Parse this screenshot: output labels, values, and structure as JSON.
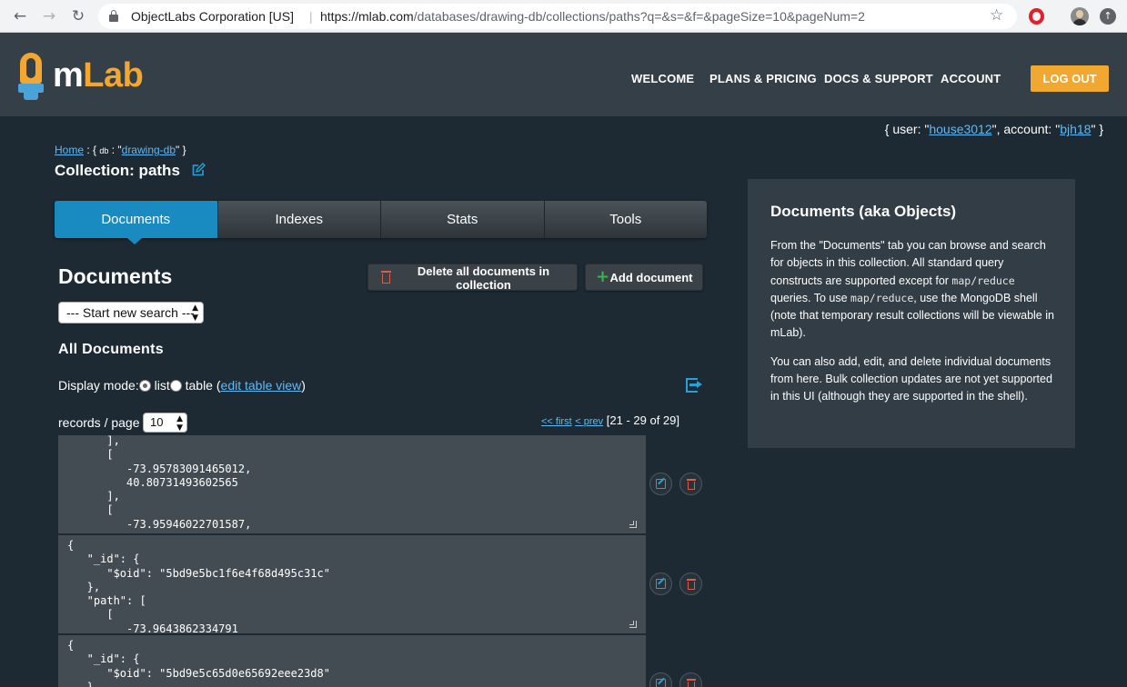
{
  "browser": {
    "site_owner": "ObjectLabs Corporation [US]",
    "separator": "|",
    "url_host": "https://mlab.com",
    "url_path": "/databases/drawing-db/collections/paths?q=&s=&f=&pageSize=10&pageNum=2",
    "icons": [
      "back-arrow-icon",
      "forward-arrow-icon",
      "reload-icon",
      "lock-icon",
      "star-icon",
      "opera-icon",
      "profile-avatar-icon",
      "update-icon"
    ]
  },
  "header": {
    "logo_m": "m",
    "logo_lab": "Lab",
    "nav": [
      "WELCOME",
      "PLANS & PRICING",
      "DOCS & SUPPORT",
      "ACCOUNT"
    ],
    "logout_label": "LOG OUT",
    "accent_color": "#f0a830",
    "background_color": "#353f47"
  },
  "userline": {
    "prefix": "{ user: \"",
    "user": "house3012",
    "middle": "\", account: \"",
    "account": "bjh18",
    "suffix": "\" }"
  },
  "breadcrumb": {
    "home": "Home",
    "sep1": " : { ",
    "db_label": "db",
    "sep2": " : \"",
    "db_name": "drawing-db",
    "sep3": "\" }"
  },
  "collection_title": "Collection: paths",
  "tabs": [
    {
      "label": "Documents",
      "active": true
    },
    {
      "label": "Indexes",
      "active": false
    },
    {
      "label": "Stats",
      "active": false
    },
    {
      "label": "Tools",
      "active": false
    }
  ],
  "documents": {
    "heading": "Documents",
    "delete_all_label": "Delete all documents in collection",
    "add_label": "Add document",
    "search_select_value": "--- Start new search ---",
    "all_documents_heading": "All Documents",
    "display_mode_label": "Display mode:",
    "mode_list": "list",
    "mode_table": "table (",
    "edit_table_view": "edit table view",
    "mode_close": ")",
    "records_per_page_label": "records / page",
    "page_size": "10",
    "pager_first": "<< first",
    "pager_prev": "< prev",
    "pager_range": "[21 - 29 of 29]",
    "items": [
      {
        "text": "      ],\n      [\n         -73.95783091465012,\n         40.80731493602565\n      ],\n      [\n         -73.95946022701587,"
      },
      {
        "text": "{\n   \"_id\": {\n      \"$oid\": \"5bd9e5bc1f6e4f68d495c31c\"\n   },\n   \"path\": [\n      [\n         -73.9643862334791"
      },
      {
        "text": "{\n   \"_id\": {\n      \"$oid\": \"5bd9e5c65d0e65692eee23d8\"\n   },"
      }
    ]
  },
  "info_panel": {
    "title": "Documents (aka Objects)",
    "p1_a": "From the \"Documents\" tab you can browse and search for objects in this collection. All standard query constructs are supported except for ",
    "p1_code1": "map/reduce",
    "p1_b": " queries. To use ",
    "p1_code2": "map/reduce",
    "p1_c": ", use the MongoDB shell (note that temporary result collections will be viewable in mLab).",
    "p2": "You can also add, edit, and delete individual documents from here. Bulk collection updates are not yet supported in this UI (although they are supported in the shell)."
  }
}
